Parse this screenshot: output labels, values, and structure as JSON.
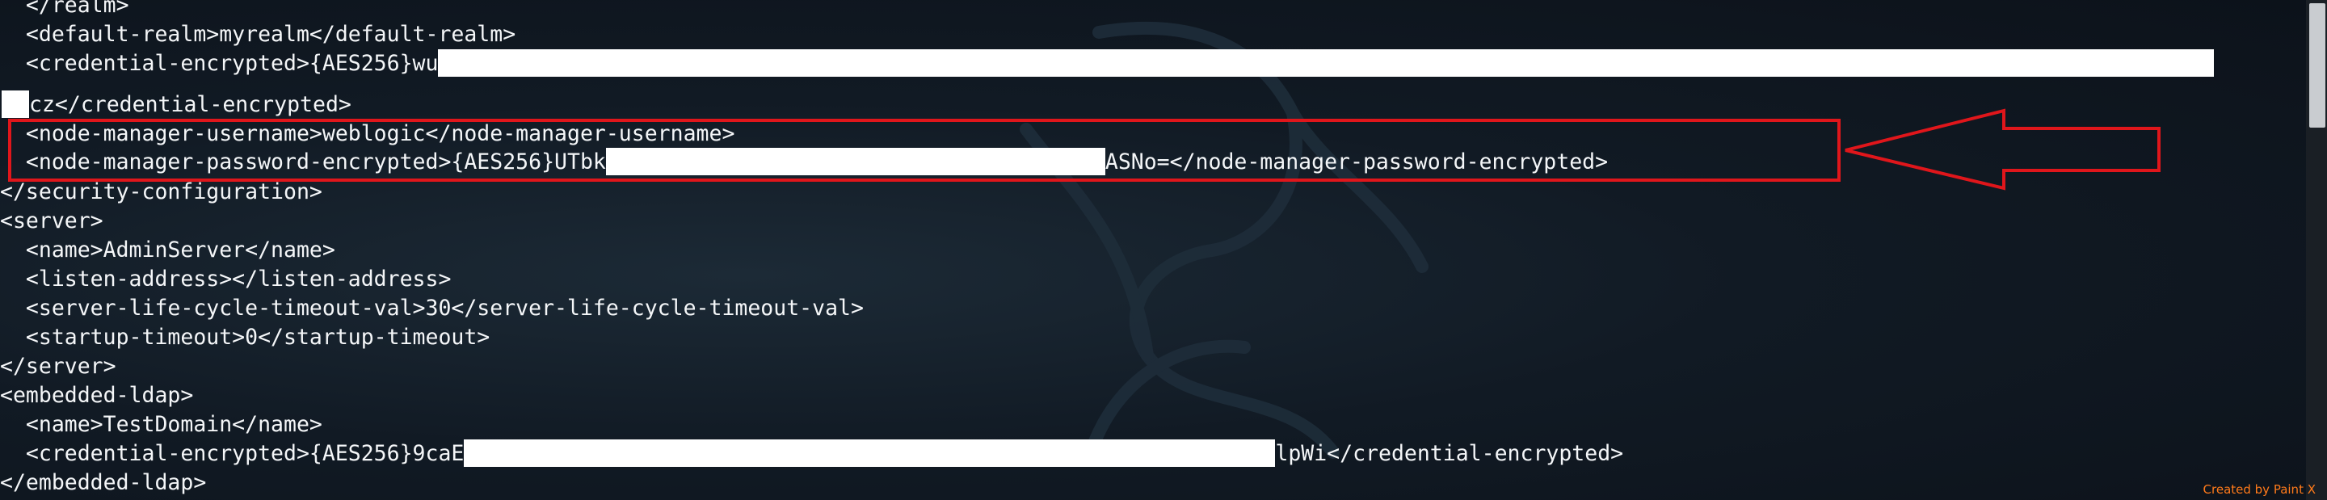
{
  "terminal": {
    "lines": [
      "  </realm>",
      "  <default-realm>myrealm</default-realm>",
      "  <credential-encrypted>{AES256}wu",
      "cz</credential-encrypted>",
      "  <node-manager-username>weblogic</node-manager-username>",
      "  <node-manager-password-encrypted>{AES256}UTbk",
      "ASNo=</node-manager-password-encrypted>",
      "</security-configuration>",
      "<server>",
      "  <name>AdminServer</name>",
      "  <listen-address></listen-address>",
      "  <server-life-cycle-timeout-val>30</server-life-cycle-timeout-val>",
      "  <startup-timeout>0</startup-timeout>",
      "</server>",
      "<embedded-ldap>",
      "  <name>TestDomain</name>",
      "  <credential-encrypted>{AES256}9caE",
      "lpWi</credential-encrypted>",
      "</embedded-ldap>"
    ]
  },
  "annotation": {
    "box_color": "#e0161b",
    "arrow_color": "#e0161b",
    "credit": "Created by Paint X",
    "credit_color": "#ff7a1a"
  },
  "colors": {
    "text": "#f4f6f8",
    "background": "#111a24",
    "redaction": "#ffffff"
  }
}
